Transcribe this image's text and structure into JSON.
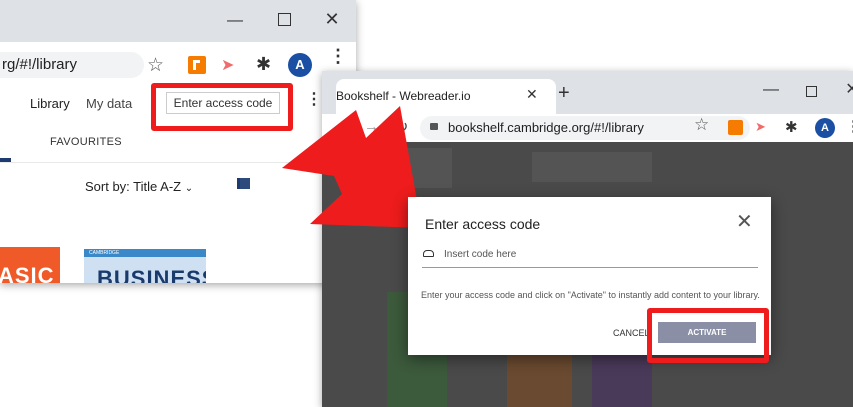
{
  "left_window": {
    "url": "rg/#!/library",
    "nav": {
      "library": "Library",
      "my_data": "My data",
      "access_code": "Enter access code"
    },
    "favourites": "FAVOURITES",
    "sort": "Sort by: Title A-Z",
    "covers": {
      "first": "ASIC",
      "second_small": "CAMBRIDGE",
      "second": "BUSINESS"
    },
    "avatar": "A"
  },
  "right_window": {
    "tab_title": "Bookshelf - Webreader.io",
    "url": "bookshelf.cambridge.org/#!/library",
    "avatar": "A"
  },
  "modal": {
    "title": "Enter access code",
    "placeholder": "Insert code here",
    "description": "Enter your access code and click on \"Activate\" to instantly add content to your library.",
    "cancel": "CANCEL",
    "activate": "ACTIVATE"
  },
  "colors": {
    "highlight": "#ee1c1c",
    "activate": "#8a8fa6",
    "avatar": "#1a4fa3"
  }
}
